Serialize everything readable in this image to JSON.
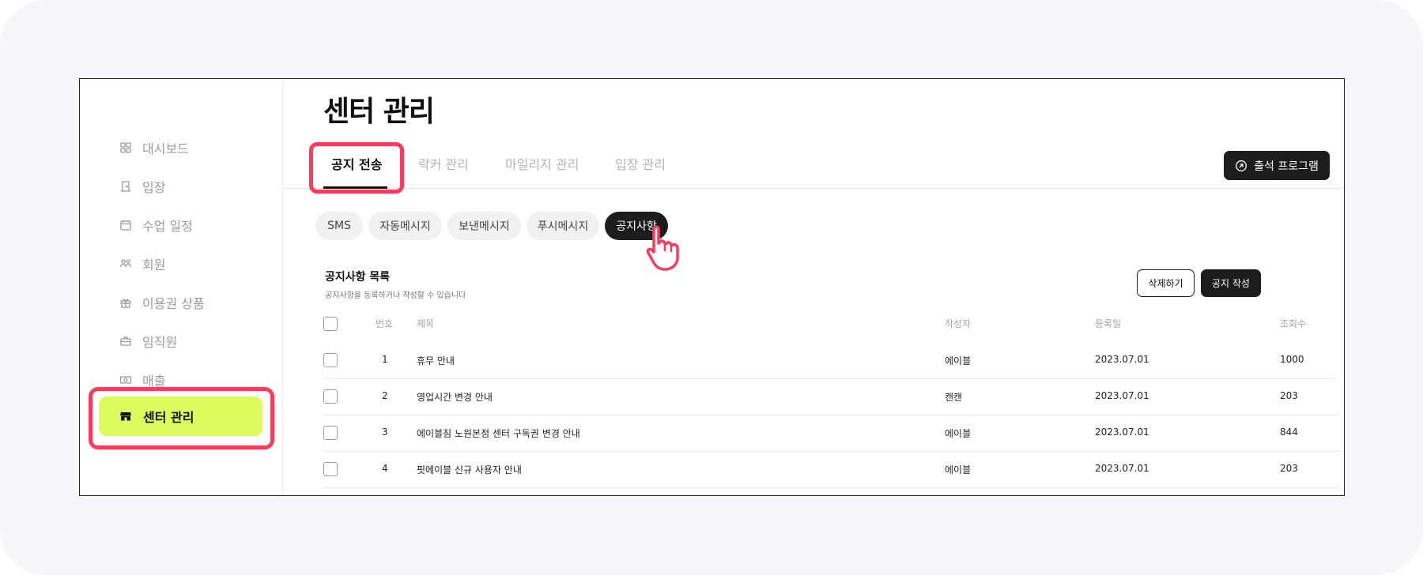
{
  "sidebar": {
    "items": [
      {
        "label": "대시보드",
        "icon": "grid-icon"
      },
      {
        "label": "입장",
        "icon": "door-icon"
      },
      {
        "label": "수업 일정",
        "icon": "calendar-icon"
      },
      {
        "label": "회원",
        "icon": "members-icon"
      },
      {
        "label": "이용권 상품",
        "icon": "gift-icon"
      },
      {
        "label": "임직원",
        "icon": "briefcase-icon"
      },
      {
        "label": "매출",
        "icon": "money-icon"
      }
    ],
    "active": {
      "label": "센터 관리",
      "icon": "store-icon"
    }
  },
  "page": {
    "title": "센터 관리"
  },
  "tabs": [
    {
      "label": "공지 전송",
      "active": true
    },
    {
      "label": "락커 관리",
      "active": false
    },
    {
      "label": "마일리지 관리",
      "active": false
    },
    {
      "label": "입장 관리",
      "active": false
    }
  ],
  "attend_button": {
    "label": "출석 프로그램",
    "icon": "arrow-up-right-circle-icon"
  },
  "chips": [
    {
      "label": "SMS",
      "active": false
    },
    {
      "label": "자동메시지",
      "active": false
    },
    {
      "label": "보낸메시지",
      "active": false
    },
    {
      "label": "푸시메시지",
      "active": false
    },
    {
      "label": "공지사항",
      "active": true
    }
  ],
  "list": {
    "title": "공지사항 목록",
    "subtitle": "공지사항을 등록하거나 작성할 수 있습니다",
    "delete_label": "삭제하기",
    "write_label": "공지 작성"
  },
  "table": {
    "headers": {
      "no": "번호",
      "title": "제목",
      "author": "작성자",
      "date": "등록일",
      "views": "조회수"
    },
    "rows": [
      {
        "no": "1",
        "title": "휴무 안내",
        "author": "에이블",
        "date": "2023.07.01",
        "views": "1000"
      },
      {
        "no": "2",
        "title": "영업시간 변경 안내",
        "author": "캔캔",
        "date": "2023.07.01",
        "views": "203"
      },
      {
        "no": "3",
        "title": "에이블짐 노원본점 센터 구독권 변경 안내",
        "author": "에이블",
        "date": "2023.07.01",
        "views": "844"
      },
      {
        "no": "4",
        "title": "핏에이블 신규 사용자 안내",
        "author": "에이블",
        "date": "2023.07.01",
        "views": "203"
      }
    ]
  },
  "colors": {
    "accent": "#ddfb5c",
    "highlight": "#ff3b5c",
    "dark": "#1c1c1c"
  }
}
